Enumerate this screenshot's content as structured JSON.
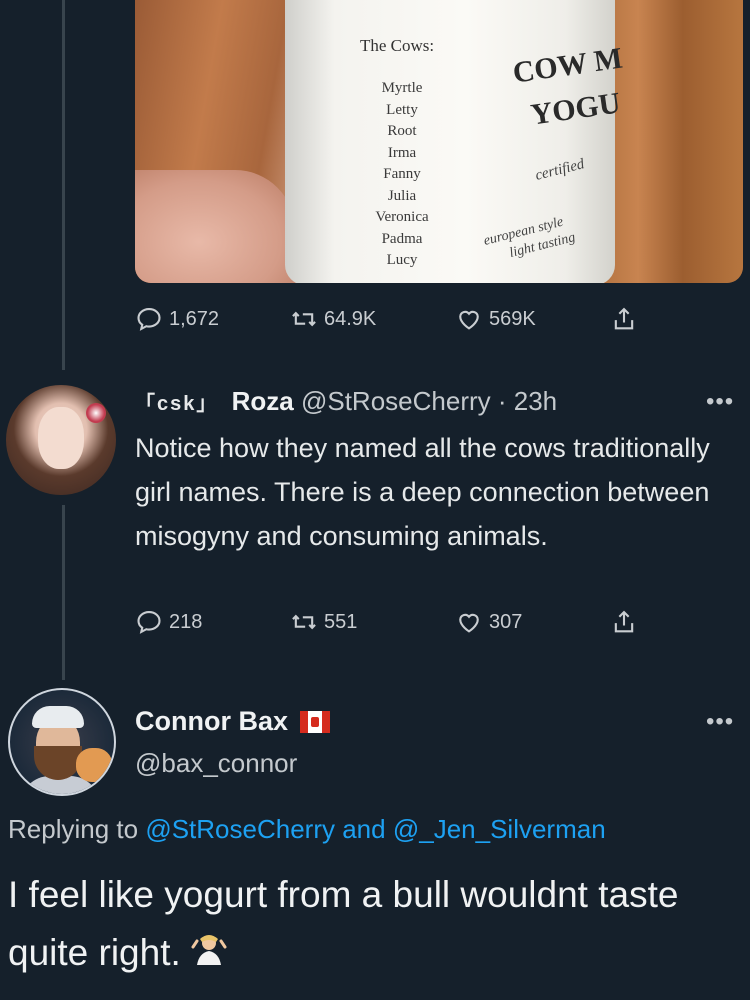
{
  "tweet1": {
    "image": {
      "cows_title": "The Cows:",
      "cow_names": [
        "Myrtle",
        "Letty",
        "Root",
        "Irma",
        "Fanny",
        "Julia",
        "Veronica",
        "Padma",
        "Lucy"
      ],
      "brand_lines": [
        "COW M",
        "YOGU"
      ],
      "certified": "certified",
      "euro_lines": [
        "european style",
        "light tasting"
      ]
    },
    "stats": {
      "replies": "1,672",
      "retweets": "64.9K",
      "likes": "569K"
    }
  },
  "tweet2": {
    "badge": "「csk」",
    "display_name": "Roza",
    "handle_time": "@StRoseCherry · 23h",
    "more": "•••",
    "text": "Notice how they named all the cows traditionally girl names. There is a deep connection between misogyny and consuming animals.",
    "stats": {
      "replies": "218",
      "retweets": "551",
      "likes": "307"
    }
  },
  "tweet3": {
    "display_name": "Connor Bax",
    "handle": "@bax_connor",
    "more": "•••",
    "replying_prefix": "Replying to",
    "mention1": "@StRoseCherry",
    "and_word": "and",
    "mention2": "@_Jen_Silverman",
    "text": "I feel like yogurt from a bull wouldnt taste quite right."
  },
  "icons": [
    "reply-icon",
    "retweet-icon",
    "like-icon",
    "share-icon",
    "canada-flag-icon",
    "shrug-emoji-icon"
  ],
  "colors": {
    "background": "#15202b",
    "link": "#1da1f2",
    "thread_line": "#38444d"
  }
}
